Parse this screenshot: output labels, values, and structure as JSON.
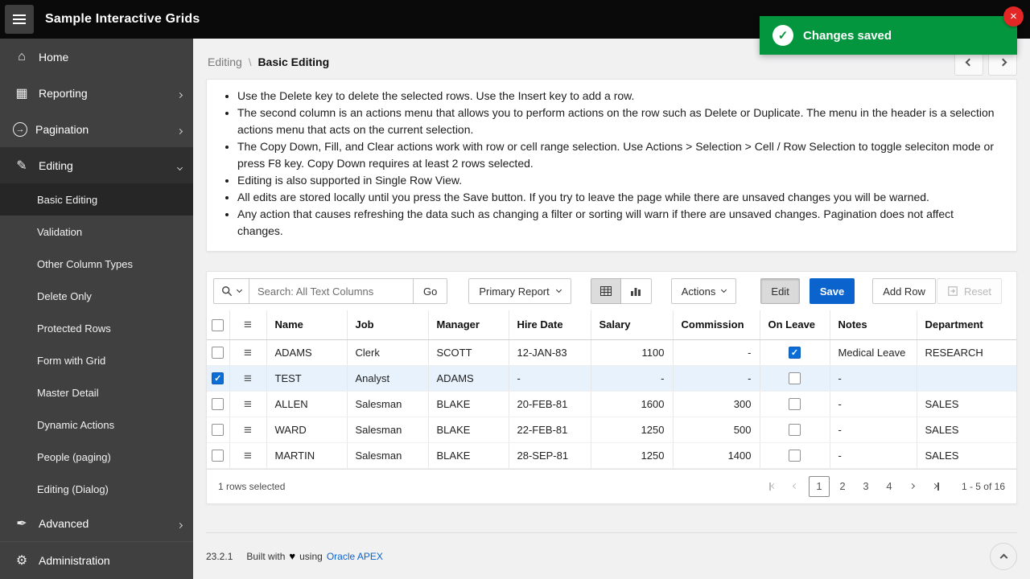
{
  "colors": {
    "success_green": "#04963e",
    "primary_blue": "#0b64cd",
    "close_red": "#e32726",
    "selected_row_blue": "#e7f2fc",
    "sidebar_gray": "#404040"
  },
  "topbar": {
    "title": "Sample Interactive Grids"
  },
  "toast": {
    "message": "Changes saved"
  },
  "sidebar": {
    "items": [
      {
        "label": "Home"
      },
      {
        "label": "Reporting",
        "expandable": true
      },
      {
        "label": "Pagination",
        "expandable": true
      },
      {
        "label": "Editing",
        "expandable": true,
        "expanded": true
      },
      {
        "label": "Advanced",
        "expandable": true
      },
      {
        "label": "Administration"
      }
    ],
    "editing_children": [
      {
        "label": "Basic Editing",
        "active": true
      },
      {
        "label": "Validation"
      },
      {
        "label": "Other Column Types"
      },
      {
        "label": "Delete Only"
      },
      {
        "label": "Protected Rows"
      },
      {
        "label": "Form with Grid"
      },
      {
        "label": "Master Detail"
      },
      {
        "label": "Dynamic Actions"
      },
      {
        "label": "People (paging)"
      },
      {
        "label": "Editing (Dialog)"
      }
    ]
  },
  "breadcrumb": {
    "parent": "Editing",
    "separator": "\\",
    "current": "Basic Editing"
  },
  "info": {
    "bullets": [
      "Use the Delete key to delete the selected rows. Use the Insert key to add a row.",
      "The second column is an actions menu that allows you to perform actions on the row such as Delete or Duplicate. The menu in the header is a selection actions menu that acts on the current selection.",
      "The Copy Down, Fill, and Clear actions work with row or cell range selection. Use Actions > Selection > Cell / Row Selection to toggle seleciton mode or press F8 key. Copy Down requires at least 2 rows selected.",
      "Editing is also supported in Single Row View.",
      "All edits are stored locally until you press the Save button. If you try to leave the page while there are unsaved changes you will be warned.",
      "Any action that causes refreshing the data such as changing a filter or sorting will warn if there are unsaved changes. Pagination does not affect changes."
    ]
  },
  "toolbar": {
    "search_placeholder": "Search: All Text Columns",
    "go_label": "Go",
    "report_selector": "Primary Report",
    "actions_label": "Actions",
    "edit_label": "Edit",
    "edit_active": true,
    "save_label": "Save",
    "add_row_label": "Add Row",
    "reset_label": "Reset",
    "grid_view_active": true
  },
  "grid": {
    "columns": [
      {
        "label": "Name"
      },
      {
        "label": "Job"
      },
      {
        "label": "Manager"
      },
      {
        "label": "Hire Date"
      },
      {
        "label": "Salary"
      },
      {
        "label": "Commission"
      },
      {
        "label": "On Leave"
      },
      {
        "label": "Notes"
      },
      {
        "label": "Department"
      }
    ],
    "rows": [
      {
        "name": "ADAMS",
        "job": "Clerk",
        "manager": "SCOTT",
        "hire_date": "12-JAN-83",
        "salary": "1100",
        "commission": "-",
        "on_leave": true,
        "notes": "Medical Leave",
        "department": "RESEARCH",
        "selected": false
      },
      {
        "name": "TEST",
        "job": "Analyst",
        "manager": "ADAMS",
        "hire_date": "-",
        "salary": "-",
        "commission": "-",
        "on_leave": false,
        "notes": "-",
        "department": "",
        "selected": true
      },
      {
        "name": "ALLEN",
        "job": "Salesman",
        "manager": "BLAKE",
        "hire_date": "20-FEB-81",
        "salary": "1600",
        "commission": "300",
        "on_leave": false,
        "notes": "-",
        "department": "SALES",
        "selected": false
      },
      {
        "name": "WARD",
        "job": "Salesman",
        "manager": "BLAKE",
        "hire_date": "22-FEB-81",
        "salary": "1250",
        "commission": "500",
        "on_leave": false,
        "notes": "-",
        "department": "SALES",
        "selected": false
      },
      {
        "name": "MARTIN",
        "job": "Salesman",
        "manager": "BLAKE",
        "hire_date": "28-SEP-81",
        "salary": "1250",
        "commission": "1400",
        "on_leave": false,
        "notes": "-",
        "department": "SALES",
        "selected": false
      }
    ]
  },
  "status_bar": {
    "selection_text": "1 rows selected",
    "pages": [
      {
        "label": "1",
        "current": true
      },
      {
        "label": "2"
      },
      {
        "label": "3"
      },
      {
        "label": "4"
      }
    ],
    "range_text": "1 - 5 of 16"
  },
  "footer": {
    "version": "23.2.1",
    "built_with": "Built with",
    "using": "using",
    "link": "Oracle APEX"
  }
}
